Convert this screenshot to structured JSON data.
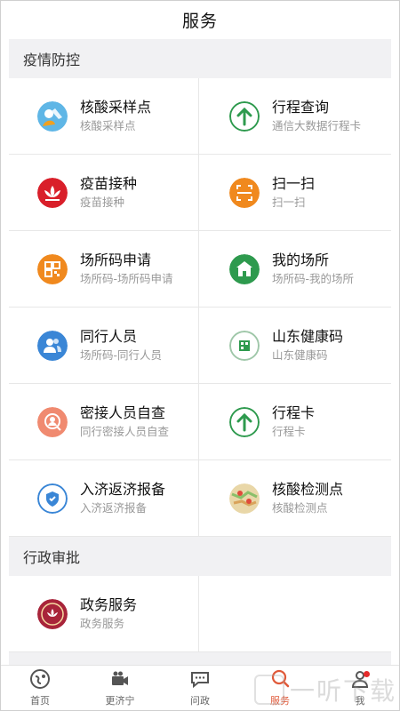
{
  "header": {
    "title": "服务"
  },
  "sections": [
    {
      "title": "疫情防控",
      "items": [
        {
          "title": "核酸采样点",
          "sub": "核酸采样点",
          "icon": "nucleic-sampling-icon"
        },
        {
          "title": "行程查询",
          "sub": "通信大数据行程卡",
          "icon": "itinerary-arrow-icon"
        },
        {
          "title": "疫苗接种",
          "sub": "疫苗接种",
          "icon": "vaccine-lotus-icon"
        },
        {
          "title": "扫一扫",
          "sub": "扫一扫",
          "icon": "scan-icon"
        },
        {
          "title": "场所码申请",
          "sub": "场所码-场所码申请",
          "icon": "qr-code-icon"
        },
        {
          "title": "我的场所",
          "sub": "场所码-我的场所",
          "icon": "venue-icon"
        },
        {
          "title": "同行人员",
          "sub": "场所码-同行人员",
          "icon": "companions-icon"
        },
        {
          "title": "山东健康码",
          "sub": "山东健康码",
          "icon": "health-code-icon"
        },
        {
          "title": "密接人员自查",
          "sub": "同行密接人员自查",
          "icon": "close-contact-icon"
        },
        {
          "title": "行程卡",
          "sub": "行程卡",
          "icon": "itinerary-card-icon"
        },
        {
          "title": "入济返济报备",
          "sub": "入济返济报备",
          "icon": "report-shield-icon"
        },
        {
          "title": "核酸检测点",
          "sub": "核酸检测点",
          "icon": "testing-map-icon"
        }
      ]
    },
    {
      "title": "行政审批",
      "items": [
        {
          "title": "政务服务",
          "sub": "政务服务",
          "icon": "government-service-icon"
        }
      ]
    }
  ],
  "tabs": [
    {
      "label": "首页",
      "icon": "home-globe-icon",
      "active": false
    },
    {
      "label": "更济宁",
      "icon": "video-camera-icon",
      "active": false
    },
    {
      "label": "问政",
      "icon": "chat-bubble-icon",
      "active": false
    },
    {
      "label": "服务",
      "icon": "service-search-icon",
      "active": true
    },
    {
      "label": "我",
      "icon": "profile-icon",
      "active": false,
      "badge": true
    }
  ],
  "colors": {
    "accent": "#e05a3a",
    "green": "#2e9a4e",
    "orange": "#f0891e",
    "red": "#d91f2a",
    "blue": "#3a86d6",
    "salmon": "#f08a70"
  },
  "watermark": {
    "text": "一听下载"
  }
}
